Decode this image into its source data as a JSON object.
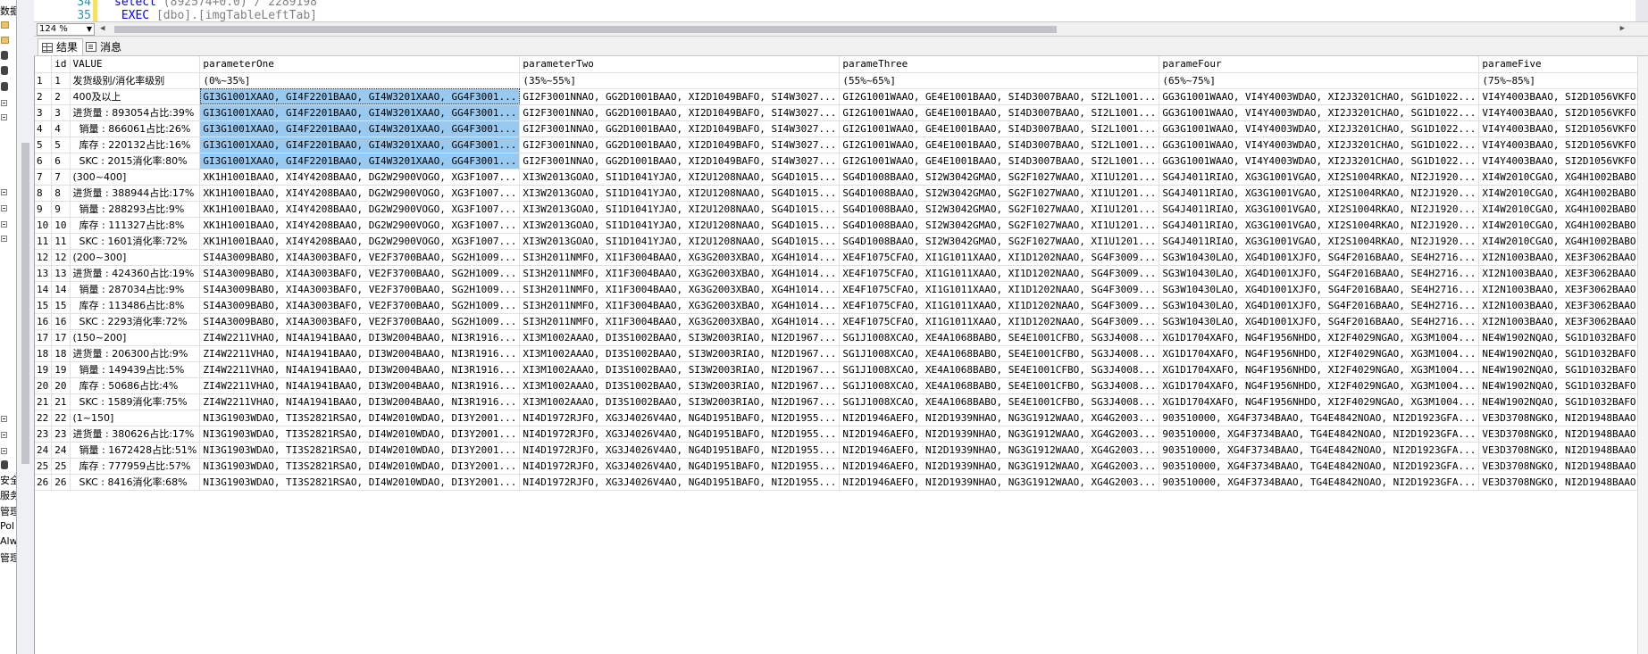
{
  "editor": {
    "lines": [
      {
        "no": "34",
        "tokens": [
          {
            "t": "select",
            "c": "kw"
          },
          {
            "t": " (892574+0.0) / 2289198",
            "c": "str"
          }
        ]
      },
      {
        "no": "35",
        "tokens": [
          {
            "t": " EXEC",
            "c": "kw"
          },
          {
            "t": " [dbo].[imgTableLeftTab]",
            "c": "str"
          }
        ]
      }
    ]
  },
  "zoom": {
    "value": "124 %"
  },
  "tabs": [
    {
      "label": "结果",
      "icon": "grid-icon"
    },
    {
      "label": "消息",
      "icon": "messages-icon"
    }
  ],
  "left_strip": [
    "数据",
    "安全",
    "服务",
    "管理",
    "Pol",
    "Alw",
    "管理"
  ],
  "grid": {
    "columns": [
      "",
      "id",
      "VALUE",
      "parameterOne",
      "parameterTwo",
      "parameThree",
      "parameFour",
      "parameFive"
    ],
    "rows": [
      [
        "1",
        "1",
        "发货级别/消化率级别",
        "(0%~35%]",
        "(35%~55%]",
        "(55%~65%]",
        "(65%~75%]",
        "(75%~85%]"
      ],
      [
        "2",
        "2",
        "400及以上",
        "GI3G1001XAAO, GI4F2201BAAO, GI4W3201XAAO, GG4F3001...",
        "GI2F3001NNAO, GG2D1001BAAO, XI2D1049BAFO, SI4W3027...",
        "GI2G1001WAAO, GE4E1001BAAO, SI4D3007BAAO, SI2L1001...",
        "GG3G1001WAAO, VI4Y4003WDAO, XI2J3201CHAO, SG1D1022...",
        "VI4Y4003BAAO, SI2D1056VKFO, SG2D1125WAFO, VI4Y4003..."
      ],
      [
        "3",
        "3",
        "进货量 : 893054占比:39%",
        "GI3G1001XAAO, GI4F2201BAAO, GI4W3201XAAO, GG4F3001...",
        "GI2F3001NNAO, GG2D1001BAAO, XI2D1049BAFO, SI4W3027...",
        "GI2G1001WAAO, GE4E1001BAAO, SI4D3007BAAO, SI2L1001...",
        "GG3G1001WAAO, VI4Y4003WDAO, XI2J3201CHAO, SG1D1022...",
        "VI4Y4003BAAO, SI2D1056VKFO, SG2D1125WAFO, VI4Y4003..."
      ],
      [
        "4",
        "4",
        "  销量 : 866061占比:26%",
        "GI3G1001XAAO, GI4F2201BAAO, GI4W3201XAAO, GG4F3001...",
        "GI2F3001NNAO, GG2D1001BAAO, XI2D1049BAFO, SI4W3027...",
        "GI2G1001WAAO, GE4E1001BAAO, SI4D3007BAAO, SI2L1001...",
        "GG3G1001WAAO, VI4Y4003WDAO, XI2J3201CHAO, SG1D1022...",
        "VI4Y4003BAAO, SI2D1056VKFO, SG2D1125WAFO, VI4Y4003..."
      ],
      [
        "5",
        "5",
        "  库存 : 220132占比:16%",
        "GI3G1001XAAO, GI4F2201BAAO, GI4W3201XAAO, GG4F3001...",
        "GI2F3001NNAO, GG2D1001BAAO, XI2D1049BAFO, SI4W3027...",
        "GI2G1001WAAO, GE4E1001BAAO, SI4D3007BAAO, SI2L1001...",
        "GG3G1001WAAO, VI4Y4003WDAO, XI2J3201CHAO, SG1D1022...",
        "VI4Y4003BAAO, SI2D1056VKFO, SG2D1125WAFO, VI4Y4003..."
      ],
      [
        "6",
        "6",
        "  SKC : 2015消化率:80%",
        "GI3G1001XAAO, GI4F2201BAAO, GI4W3201XAAO, GG4F3001...",
        "GI2F3001NNAO, GG2D1001BAAO, XI2D1049BAFO, SI4W3027...",
        "GI2G1001WAAO, GE4E1001BAAO, SI4D3007BAAO, SI2L1001...",
        "GG3G1001WAAO, VI4Y4003WDAO, XI2J3201CHAO, SG1D1022...",
        "VI4Y4003BAAO, SI2D1056VKFO, SG2D1125WAFO, VI4Y4003..."
      ],
      [
        "7",
        "7",
        "(300~400]",
        "XK1H1001BAAO, XI4Y4208BAAO, DG2W2900VOGO, XG3F1007...",
        "XI3W2013GOAO, SI1D1041YJAO, XI2U1208NAAO, SG4D1015...",
        "SG4D1008BAAO, SI2W3042GMAO, SG2F1027WAAO, XI1U1201...",
        "SG4J4011RIAO, XG3G1001VGAO, XI2S1004RKAO, NI2J1920...",
        "XI4W2010CGAO, XG4H1002BABO, XG4E2209BAAO, SG4W1036..."
      ],
      [
        "8",
        "8",
        "进货量 : 388944占比:17%",
        "XK1H1001BAAO, XI4Y4208BAAO, DG2W2900VOGO, XG3F1007...",
        "XI3W2013GOAO, SI1D1041YJAO, XI2U1208NAAO, SG4D1015...",
        "SG4D1008BAAO, SI2W3042GMAO, SG2F1027WAAO, XI1U1201...",
        "SG4J4011RIAO, XG3G1001VGAO, XI2S1004RKAO, NI2J1920...",
        "XI4W2010CGAO, XG4H1002BABO, XG4E2209BAAO, SG4W1036..."
      ],
      [
        "9",
        "9",
        "  销量 : 288293占比:9%",
        "XK1H1001BAAO, XI4Y4208BAAO, DG2W2900VOGO, XG3F1007...",
        "XI3W2013GOAO, SI1D1041YJAO, XI2U1208NAAO, SG4D1015...",
        "SG4D1008BAAO, SI2W3042GMAO, SG2F1027WAAO, XI1U1201...",
        "SG4J4011RIAO, XG3G1001VGAO, XI2S1004RKAO, NI2J1920...",
        "XI4W2010CGAO, XG4H1002BABO, XG4E2209BAAO, SG4W1036..."
      ],
      [
        "10",
        "10",
        "  库存 : 111327占比:8%",
        "XK1H1001BAAO, XI4Y4208BAAO, DG2W2900VOGO, XG3F1007...",
        "XI3W2013GOAO, SI1D1041YJAO, XI2U1208NAAO, SG4D1015...",
        "SG4D1008BAAO, SI2W3042GMAO, SG2F1027WAAO, XI1U1201...",
        "SG4J4011RIAO, XG3G1001VGAO, XI2S1004RKAO, NI2J1920...",
        "XI4W2010CGAO, XG4H1002BABO, XG4E2209BAAO, SG4W1036..."
      ],
      [
        "11",
        "11",
        "  SKC : 1601消化率:72%",
        "XK1H1001BAAO, XI4Y4208BAAO, DG2W2900VOGO, XG3F1007...",
        "XI3W2013GOAO, SI1D1041YJAO, XI2U1208NAAO, SG4D1015...",
        "SG4D1008BAAO, SI2W3042GMAO, SG2F1027WAAO, XI1U1201...",
        "SG4J4011RIAO, XG3G1001VGAO, XI2S1004RKAO, NI2J1920...",
        "XI4W2010CGAO, XG4H1002BABO, XG4E2209BAAO, SG4W1036..."
      ],
      [
        "12",
        "12",
        "(200~300]",
        "SI4A3009BABO, XI4A3003BAFO, VE2F3700BAAO, SG2H1009...",
        "SI3H2011NMFO, XI1F3004BAAO, XG3G2003XBAO, XG4H1014...",
        "XE4F1075CFAO, XI1G1011XAAO, XI1D1202NAAO, SG4F3009...",
        "SG3W10430LAO, XG4D1001XJFO, SG4F2016BAAO, SE4H2716...",
        "XI2N1003BAAO, XE3F3062BAAO, SG4W1007WDAO, TI4F2801..."
      ],
      [
        "13",
        "13",
        "进货量 : 424360占比:19%",
        "SI4A3009BABO, XI4A3003BAFO, VE2F3700BAAO, SG2H1009...",
        "SI3H2011NMFO, XI1F3004BAAO, XG3G2003XBAO, XG4H1014...",
        "XE4F1075CFAO, XI1G1011XAAO, XI1D1202NAAO, SG4F3009...",
        "SG3W10430LAO, XG4D1001XJFO, SG4F2016BAAO, SE4H2716...",
        "XI2N1003BAAO, XE3F3062BAAO, SG4W1007WDAO, TI4F2801..."
      ],
      [
        "14",
        "14",
        "  销量 : 287034占比:9%",
        "SI4A3009BABO, XI4A3003BAFO, VE2F3700BAAO, SG2H1009...",
        "SI3H2011NMFO, XI1F3004BAAO, XG3G2003XBAO, XG4H1014...",
        "XE4F1075CFAO, XI1G1011XAAO, XI1D1202NAAO, SG4F3009...",
        "SG3W10430LAO, XG4D1001XJFO, SG4F2016BAAO, SE4H2716...",
        "XI2N1003BAAO, XE3F3062BAAO, SG4W1007WDAO, TI4F2801..."
      ],
      [
        "15",
        "15",
        "  库存 : 113486占比:8%",
        "SI4A3009BABO, XI4A3003BAFO, VE2F3700BAAO, SG2H1009...",
        "SI3H2011NMFO, XI1F3004BAAO, XG3G2003XBAO, XG4H1014...",
        "XE4F1075CFAO, XI1G1011XAAO, XI1D1202NAAO, SG4F3009...",
        "SG3W10430LAO, XG4D1001XJFO, SG4F2016BAAO, SE4H2716...",
        "XI2N1003BAAO, XE3F3062BAAO, SG4W1007WDAO, TI4F2801..."
      ],
      [
        "16",
        "16",
        "  SKC : 2293消化率:72%",
        "SI4A3009BABO, XI4A3003BAFO, VE2F3700BAAO, SG2H1009...",
        "SI3H2011NMFO, XI1F3004BAAO, XG3G2003XBAO, XG4H1014...",
        "XE4F1075CFAO, XI1G1011XAAO, XI1D1202NAAO, SG4F3009...",
        "SG3W10430LAO, XG4D1001XJFO, SG4F2016BAAO, SE4H2716...",
        "XI2N1003BAAO, XE3F3062BAAO, SG4W1007WDAO, TI4F2801..."
      ],
      [
        "17",
        "17",
        "(150~200]",
        "ZI4W2211VHAO, NI4A1941BAAO, DI3W2004BAAO, NI3R1916...",
        "XI3M1002AAAO, DI3S1002BAAO, SI3W2003RIAO, NI2D1967...",
        "SG1J1008XCAO, XE4A1068BABO, SE4E1001CFBO, SG3J4008...",
        "XG1D1704XAFO, NG4F1956NHDO, XI2F4029NGAO, XG3M1004...",
        "NE4W1902NQAO, SG1D1032BAFO, NG2D1913BAAO, XE3D1102..."
      ],
      [
        "18",
        "18",
        "进货量 : 206300占比:9%",
        "ZI4W2211VHAO, NI4A1941BAAO, DI3W2004BAAO, NI3R1916...",
        "XI3M1002AAAO, DI3S1002BAAO, SI3W2003RIAO, NI2D1967...",
        "SG1J1008XCAO, XE4A1068BABO, SE4E1001CFBO, SG3J4008...",
        "XG1D1704XAFO, NG4F1956NHDO, XI2F4029NGAO, XG3M1004...",
        "NE4W1902NQAO, SG1D1032BAFO, NG2D1913BAAO, XE3D1102..."
      ],
      [
        "19",
        "19",
        "  销量 : 149439占比:5%",
        "ZI4W2211VHAO, NI4A1941BAAO, DI3W2004BAAO, NI3R1916...",
        "XI3M1002AAAO, DI3S1002BAAO, SI3W2003RIAO, NI2D1967...",
        "SG1J1008XCAO, XE4A1068BABO, SE4E1001CFBO, SG3J4008...",
        "XG1D1704XAFO, NG4F1956NHDO, XI2F4029NGAO, XG3M1004...",
        "NE4W1902NQAO, SG1D1032BAFO, NG2D1913BAAO, XE3D1102..."
      ],
      [
        "20",
        "20",
        "  库存 : 50686占比:4%",
        "ZI4W2211VHAO, NI4A1941BAAO, DI3W2004BAAO, NI3R1916...",
        "XI3M1002AAAO, DI3S1002BAAO, SI3W2003RIAO, NI2D1967...",
        "SG1J1008XCAO, XE4A1068BABO, SE4E1001CFBO, SG3J4008...",
        "XG1D1704XAFO, NG4F1956NHDO, XI2F4029NGAO, XG3M1004...",
        "NE4W1902NQAO, SG1D1032BAFO, NG2D1913BAAO, XE3D1102..."
      ],
      [
        "21",
        "21",
        "  SKC : 1589消化率:75%",
        "ZI4W2211VHAO, NI4A1941BAAO, DI3W2004BAAO, NI3R1916...",
        "XI3M1002AAAO, DI3S1002BAAO, SI3W2003RIAO, NI2D1967...",
        "SG1J1008XCAO, XE4A1068BABO, SE4E1001CFBO, SG3J4008...",
        "XG1D1704XAFO, NG4F1956NHDO, XI2F4029NGAO, XG3M1004...",
        "NE4W1902NQAO, SG1D1032BAFO, NG2D1913BAAO, XE3D1102..."
      ],
      [
        "22",
        "22",
        "(1~150]",
        "NI3G1903WDAO, TI3S2821RSAO, DI4W2010WDAO, DI3Y2001...",
        "NI4D1972RJFO, XG3J4026V4AO, NG4D1951BAFO, NI2D1955...",
        "NI2D1946AEFO, NI2D1939NHAO, NG3G1912WAAO, XG4G2003...",
        "903510000, XG4F3734BAAO, TG4E4842NOAO, NI2D1923GFA...",
        "VE3D3708NGKO, NI2D1948BAAO, 903700000, VE2D1772GXH..."
      ],
      [
        "23",
        "23",
        "进货量 : 380626占比:17%",
        "NI3G1903WDAO, TI3S2821RSAO, DI4W2010WDAO, DI3Y2001...",
        "NI4D1972RJFO, XG3J4026V4AO, NG4D1951BAFO, NI2D1955...",
        "NI2D1946AEFO, NI2D1939NHAO, NG3G1912WAAO, XG4G2003...",
        "903510000, XG4F3734BAAO, TG4E4842NOAO, NI2D1923GFA...",
        "VE3D3708NGKO, NI2D1948BAAO, 903700000, VE2D1772GXH..."
      ],
      [
        "24",
        "24",
        "  销量 : 1672428占比:51%",
        "NI3G1903WDAO, TI3S2821RSAO, DI4W2010WDAO, DI3Y2001...",
        "NI4D1972RJFO, XG3J4026V4AO, NG4D1951BAFO, NI2D1955...",
        "NI2D1946AEFO, NI2D1939NHAO, NG3G1912WAAO, XG4G2003...",
        "903510000, XG4F3734BAAO, TG4E4842NOAO, NI2D1923GFA...",
        "VE3D3708NGKO, NI2D1948BAAO, 903700000, VE2D1772GXH..."
      ],
      [
        "25",
        "25",
        "  库存 : 777959占比:57%",
        "NI3G1903WDAO, TI3S2821RSAO, DI4W2010WDAO, DI3Y2001...",
        "NI4D1972RJFO, XG3J4026V4AO, NG4D1951BAFO, NI2D1955...",
        "NI2D1946AEFO, NI2D1939NHAO, NG3G1912WAAO, XG4G2003...",
        "903510000, XG4F3734BAAO, TG4E4842NOAO, NI2D1923GFA...",
        "VE3D3708NGKO, NI2D1948BAAO, 903700000, VE2D1772GXH..."
      ],
      [
        "26",
        "26",
        "  SKC : 8416消化率:68%",
        "NI3G1903WDAO, TI3S2821RSAO, DI4W2010WDAO, DI3Y2001...",
        "NI4D1972RJFO, XG3J4026V4AO, NG4D1951BAFO, NI2D1955...",
        "NI2D1946AEFO, NI2D1939NHAO, NG3G1912WAAO, XG4G2003...",
        "903510000, XG4F3734BAAO, TG4E4842NOAO, NI2D1923GFA...",
        "VE3D3708NGKO, NI2D1948BAAO, 903700000, VE2D1772GXH..."
      ]
    ],
    "selected_column": 3,
    "selected_rows": [
      2,
      3,
      4,
      5,
      6
    ],
    "colors": {
      "selection": "#99c9ef",
      "line_number": "#2b91af",
      "keyword": "#0000ff"
    }
  }
}
